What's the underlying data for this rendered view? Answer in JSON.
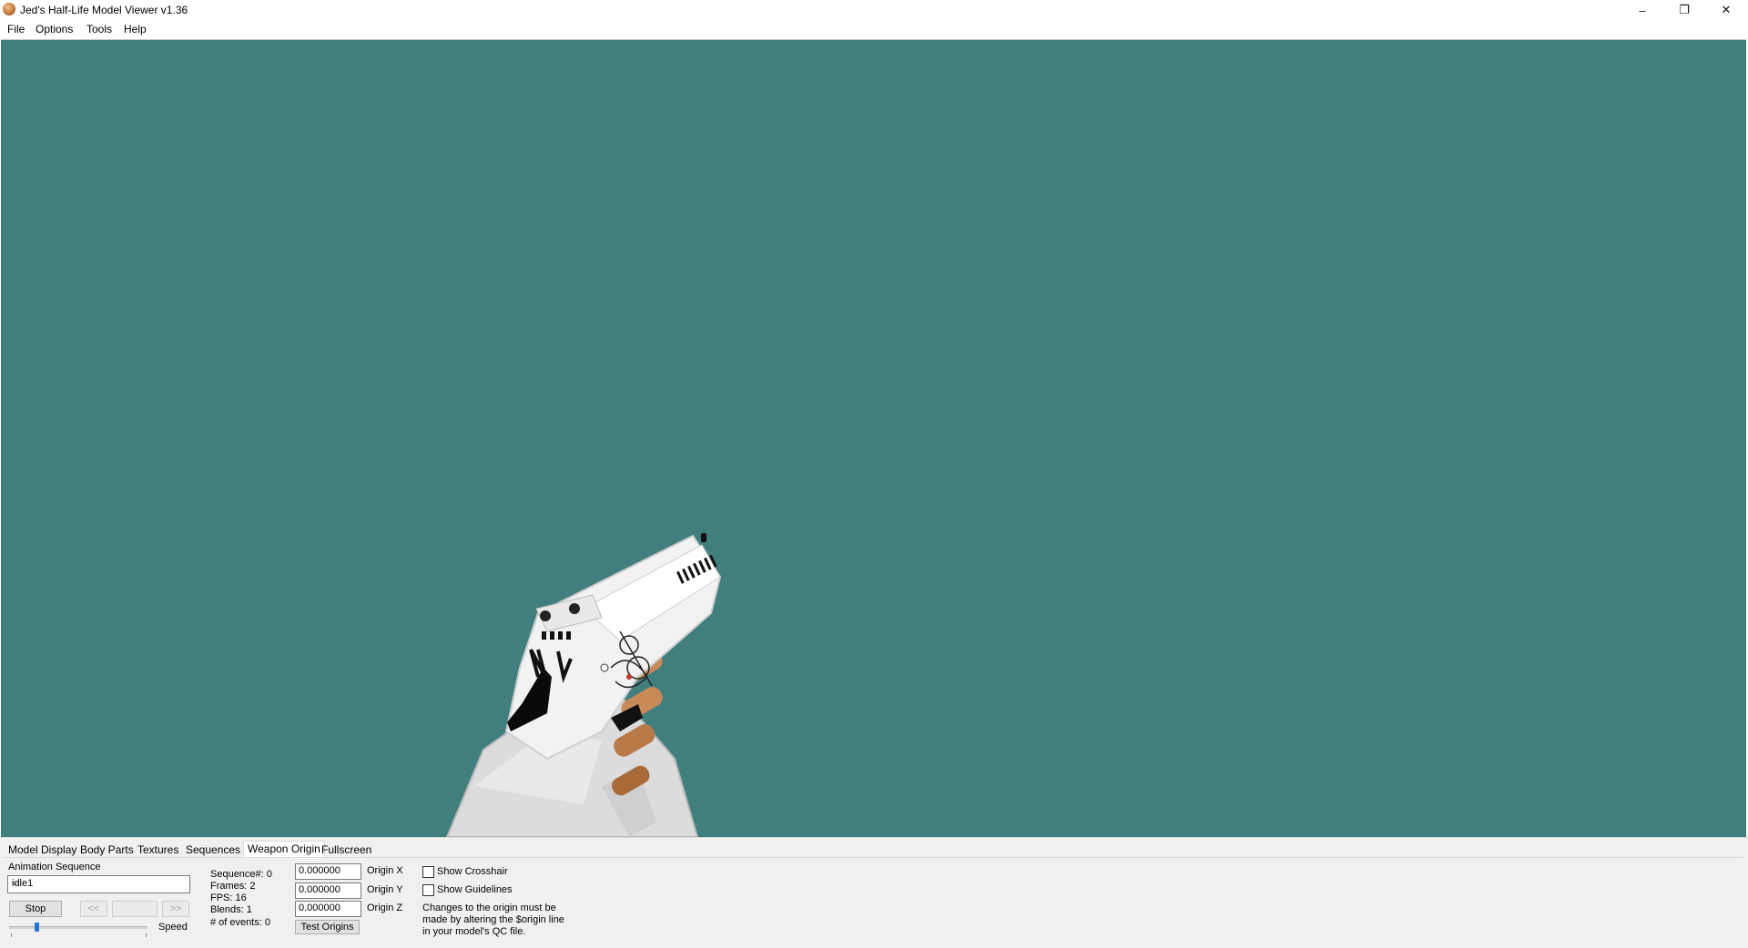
{
  "window": {
    "title": "Jed's Half-Life Model Viewer v1.36",
    "controls": {
      "minimize": "–",
      "maximize": "❐",
      "close": "✕"
    }
  },
  "menu": [
    "File",
    "Options",
    "Tools",
    "Help"
  ],
  "viewport": {
    "background": "#417f7f"
  },
  "tabs": [
    "Model Display",
    "Body Parts",
    "Textures",
    "Sequences",
    "Weapon Origin",
    "Fullscreen"
  ],
  "active_tab": "Weapon Origin",
  "animation": {
    "label": "Animation Sequence",
    "selected": "idle1",
    "stop_label": "Stop",
    "prev_label": "<<",
    "next_label": ">>",
    "speed_label": "Speed",
    "speed_fraction": 0.2
  },
  "sequence_info": {
    "sequence": "Sequence#: 0",
    "frames": "Frames: 2",
    "fps": "FPS: 16",
    "blends": "Blends: 1",
    "events": "# of events: 0"
  },
  "origin": {
    "x": {
      "value": "0.000000",
      "label": "Origin X"
    },
    "y": {
      "value": "0.000000",
      "label": "Origin Y"
    },
    "z": {
      "value": "0.000000",
      "label": "Origin Z"
    },
    "test_label": "Test Origins"
  },
  "options": {
    "crosshair": "Show Crosshair",
    "guidelines": "Show Guidelines",
    "note_line1": "Changes to the origin must be",
    "note_line2": "made by altering the $origin line",
    "note_line3": "in your model's QC file."
  }
}
